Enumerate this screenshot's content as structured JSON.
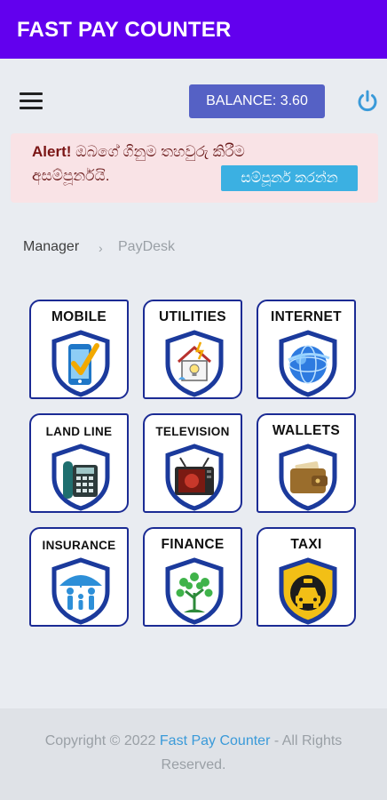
{
  "appbar": {
    "title": "FAST PAY COUNTER"
  },
  "header": {
    "balance_label": "BALANCE: 3.60"
  },
  "alert": {
    "strong": "Alert!",
    "text_line1": "ඔබගේ ගිනුම තහවුරු කිරීම",
    "text_line2": "අසම්පූර්නයි.",
    "button": "සම්පූර්න කරන්න"
  },
  "breadcrumb": {
    "item1": "Manager",
    "separator": "›",
    "item2": "PayDesk"
  },
  "services": [
    {
      "label": "MOBILE",
      "icon": "mobile-icon"
    },
    {
      "label": "UTILITIES",
      "icon": "utilities-icon"
    },
    {
      "label": "INTERNET",
      "icon": "internet-icon"
    },
    {
      "label": "LAND LINE",
      "icon": "landline-phone-icon"
    },
    {
      "label": "TELEVISION",
      "icon": "television-icon"
    },
    {
      "label": "WALLETS",
      "icon": "wallet-icon"
    },
    {
      "label": "INSURANCE",
      "icon": "insurance-umbrella-icon"
    },
    {
      "label": "FINANCE",
      "icon": "money-tree-icon"
    },
    {
      "label": "TAXI",
      "icon": "taxi-icon"
    }
  ],
  "footer": {
    "prefix": "Copyright © 2022 ",
    "link": "Fast Pay Counter",
    "suffix": " - All Rights Reserved."
  },
  "colors": {
    "appbar": "#6200ee",
    "balance": "#5561c5",
    "alert_bg": "#f9e3e6",
    "alert_button": "#3bb0e2",
    "tile_border": "#1b2b94",
    "power_icon": "#3a9ad9"
  }
}
